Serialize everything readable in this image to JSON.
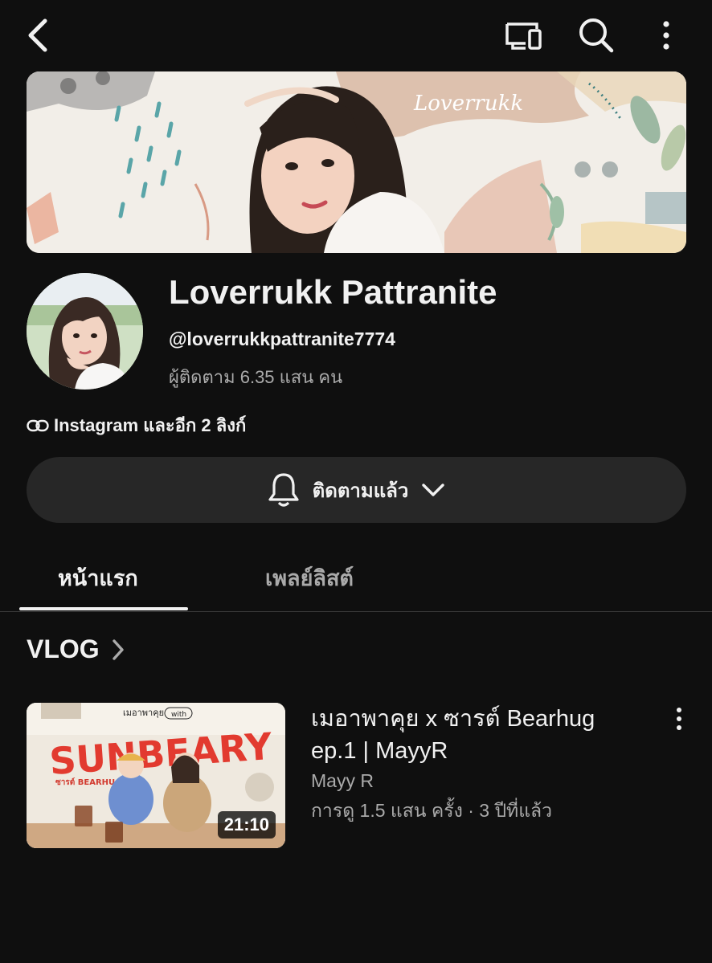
{
  "icons": {
    "back": "chevron-left-icon",
    "cast": "cast-icon",
    "search": "search-icon",
    "more": "more-vertical-icon",
    "link": "link-icon",
    "bell": "bell-icon",
    "dropdown": "chevron-down-icon",
    "section_arrow": "chevron-right-icon"
  },
  "banner": {
    "text": "Loverrukk"
  },
  "channel": {
    "name": "Loverrukk Pattranite",
    "handle": "@loverrukkpattranite7774",
    "subscribers": "ผู้ติดตาม 6.35 แสน คน",
    "links": "Instagram และอีก 2 ลิงก์"
  },
  "subscribe": {
    "label": "ติดตามแล้ว"
  },
  "tabs": [
    {
      "label": "หน้าแรก",
      "selected": true
    },
    {
      "label": "เพลย์ลิสต์",
      "selected": false
    }
  ],
  "section": {
    "title": "VLOG"
  },
  "video": {
    "title": "เมอาพาคุย x ซารต์ Bearhug ep.1 | MayyR",
    "channel": "Mayy R",
    "meta": "การดู 1.5 แสน ครั้ง · 3 ปีที่แล้ว",
    "duration": "21:10",
    "thumb_text": "SUNBEARY",
    "thumb_top_text": "เมอาพาคุย",
    "thumb_with": "with",
    "thumb_side_text": "ซารต์ BEARHUG"
  },
  "colors": {
    "background": "#0f0f0f",
    "text": "#f1f1f1",
    "secondary": "#aaaaaa",
    "button": "#272727"
  }
}
